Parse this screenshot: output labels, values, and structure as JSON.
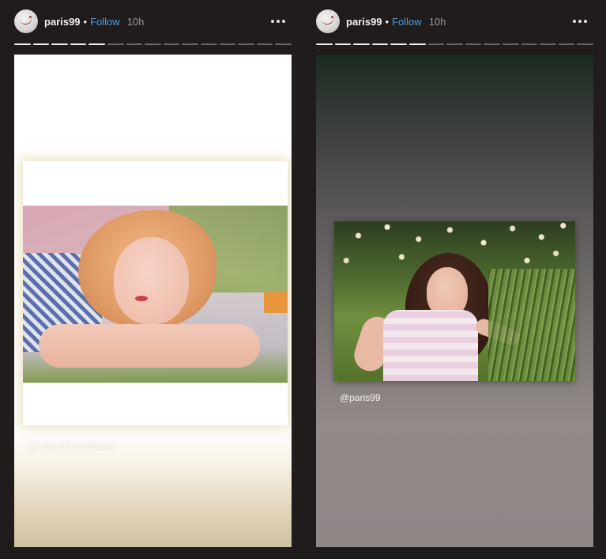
{
  "stories": [
    {
      "username": "paris99",
      "separator": "•",
      "follow_label": "Follow",
      "time": "10h",
      "progress": {
        "segments": 15,
        "completed": 5
      },
      "mention": "@redvelvet.smtown"
    },
    {
      "username": "paris99",
      "separator": "•",
      "follow_label": "Follow",
      "time": "10h",
      "progress": {
        "segments": 15,
        "completed": 6
      },
      "mention": "@paris99"
    }
  ],
  "colors": {
    "background": "#1f1c1b",
    "follow": "#4d9ee8",
    "progress_done": "#f2f2f2",
    "progress_pending": "#6b6868"
  },
  "icons": {
    "more": "more-horizontal-icon"
  }
}
